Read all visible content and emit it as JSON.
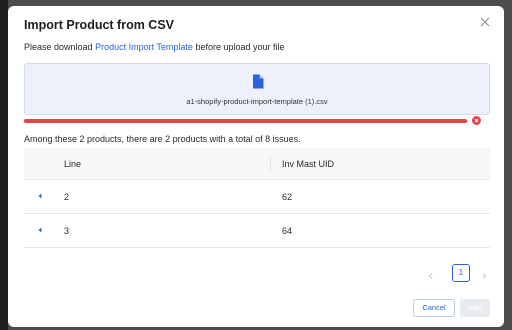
{
  "modal": {
    "title": "Import Product from CSV"
  },
  "download": {
    "prefix": "Please download ",
    "link": "Product Import Template",
    "suffix": " before upload your file"
  },
  "upload": {
    "file_name": "a1-shopify-product-import-template (1).csv",
    "progress_percent": 100,
    "status": "error"
  },
  "summary": "Among these 2 products, there are 2 products with a total of 8 issues.",
  "table": {
    "columns": [
      "Line",
      "Inv Mast UID"
    ],
    "rows": [
      {
        "line": "2",
        "inv_mast_uid": "62"
      },
      {
        "line": "3",
        "inv_mast_uid": "64"
      }
    ]
  },
  "pagination": {
    "current_page": "1"
  },
  "footer": {
    "cancel_label": "Cancel",
    "add_label": "Add"
  },
  "colors": {
    "accent": "#2a62d8",
    "error": "#e8434b"
  }
}
